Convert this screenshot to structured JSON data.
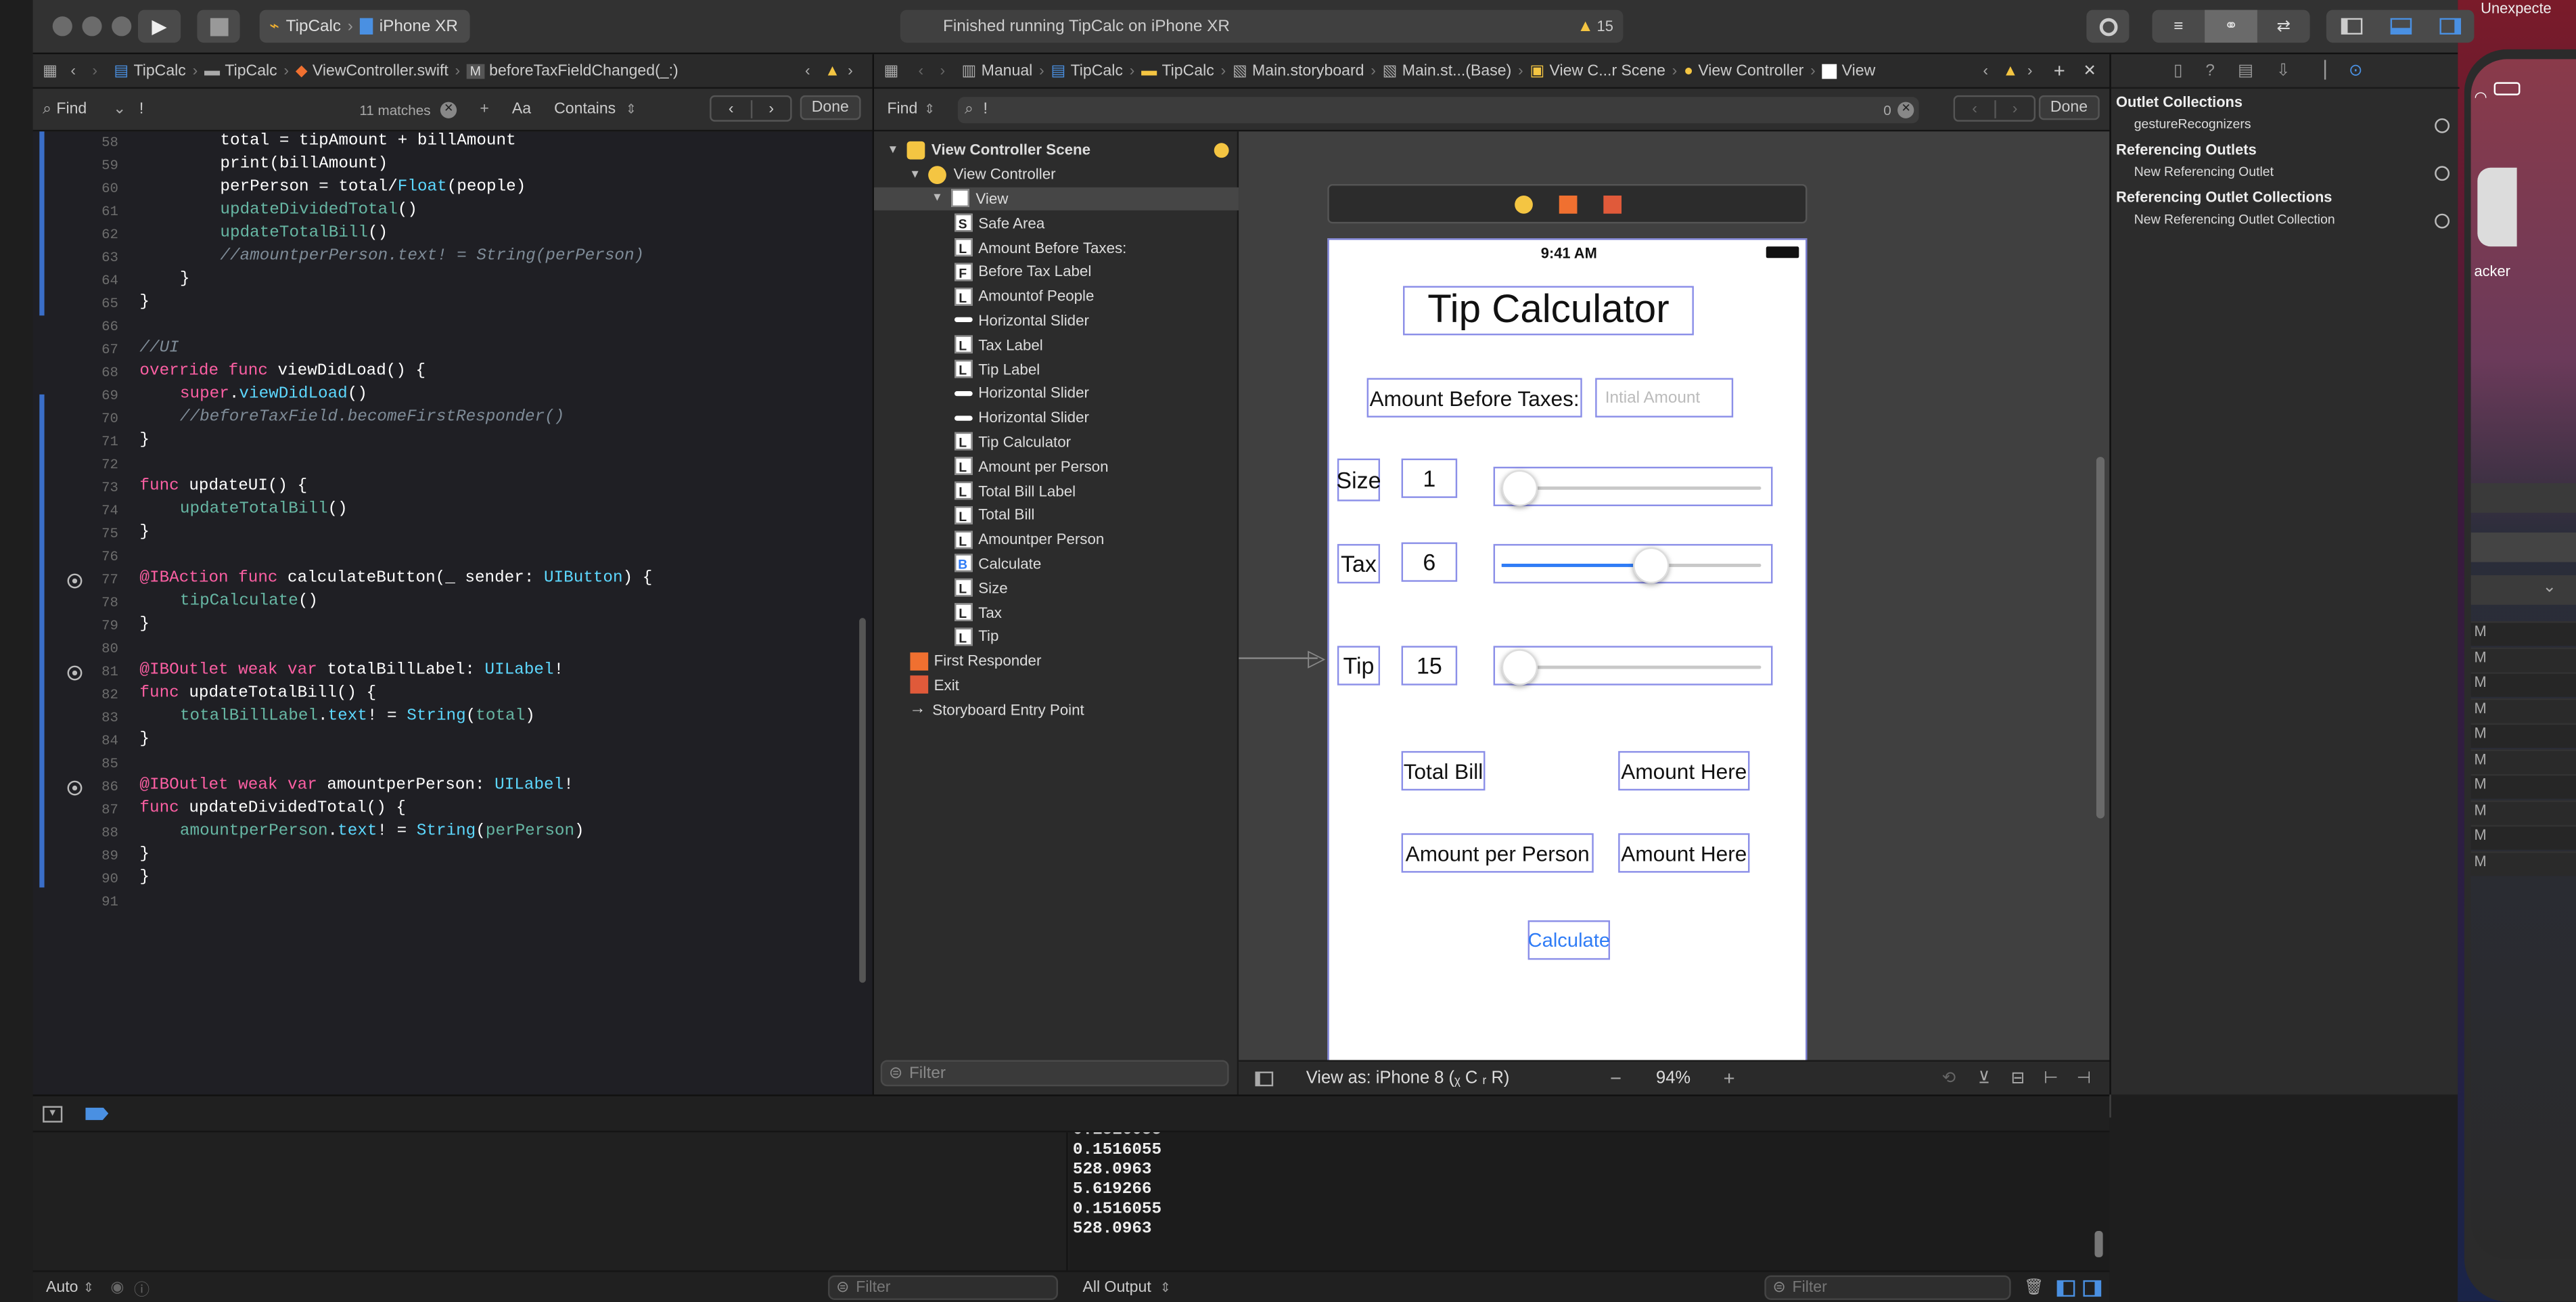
{
  "toolbar": {
    "scheme": "TipCalc",
    "device": "iPhone XR",
    "status": "Finished running TipCalc on iPhone XR",
    "warnings": "15"
  },
  "editor": {
    "jump": [
      "TipCalc",
      "TipCalc",
      "ViewController.swift",
      "M",
      "beforeTaxFieldChanged(_:)"
    ],
    "find": {
      "mode": "Find",
      "query": "!",
      "matches": "11 matches",
      "aa": "Aa",
      "contains": "Contains",
      "done": "Done"
    },
    "lines": [
      {
        "n": "58",
        "ind": 2,
        "t": [
          [
            "pl",
            "total = tipAmount + billAmount"
          ]
        ]
      },
      {
        "n": "59",
        "ind": 2,
        "t": [
          [
            "pl",
            "print(billAmount)"
          ]
        ]
      },
      {
        "n": "60",
        "ind": 2,
        "t": [
          [
            "pl",
            "perPerson = total/"
          ],
          [
            "ty",
            "Float"
          ],
          [
            "pl",
            "(people)"
          ]
        ]
      },
      {
        "n": "61",
        "ind": 2,
        "t": [
          [
            "fn",
            "updateDividedTotal"
          ],
          [
            "pl",
            "()"
          ]
        ]
      },
      {
        "n": "62",
        "ind": 2,
        "t": [
          [
            "fn",
            "updateTotalBill"
          ],
          [
            "pl",
            "()"
          ]
        ]
      },
      {
        "n": "63",
        "ind": 2,
        "t": [
          [
            "cm",
            "//amountperPerson.text! = String(perPerson)"
          ]
        ]
      },
      {
        "n": "64",
        "ind": 1,
        "t": [
          [
            "pl",
            "}"
          ]
        ]
      },
      {
        "n": "65",
        "ind": 0,
        "t": [
          [
            "pl",
            "}"
          ]
        ]
      },
      {
        "n": "66",
        "ind": 0,
        "t": []
      },
      {
        "n": "67",
        "ind": 0,
        "t": [
          [
            "cm",
            "//UI"
          ]
        ]
      },
      {
        "n": "68",
        "ind": 0,
        "t": [
          [
            "kw",
            "override func "
          ],
          [
            "pl",
            "viewDidLoad() {"
          ]
        ]
      },
      {
        "n": "69",
        "ind": 1,
        "t": [
          [
            "kw",
            "super"
          ],
          [
            "pl",
            "."
          ],
          [
            "ty",
            "viewDidLoad"
          ],
          [
            "pl",
            "()"
          ]
        ]
      },
      {
        "n": "70",
        "ind": 1,
        "t": [
          [
            "cm",
            "//beforeTaxField.becomeFirstResponder()"
          ]
        ]
      },
      {
        "n": "71",
        "ind": 0,
        "t": [
          [
            "pl",
            "}"
          ]
        ]
      },
      {
        "n": "72",
        "ind": 0,
        "t": []
      },
      {
        "n": "73",
        "ind": 0,
        "t": [
          [
            "kw",
            "func "
          ],
          [
            "pl",
            "updateUI() {"
          ]
        ]
      },
      {
        "n": "74",
        "ind": 1,
        "t": [
          [
            "fn",
            "updateTotalBill"
          ],
          [
            "pl",
            "()"
          ]
        ]
      },
      {
        "n": "75",
        "ind": 0,
        "t": [
          [
            "pl",
            "}"
          ]
        ]
      },
      {
        "n": "76",
        "ind": 0,
        "t": []
      },
      {
        "n": "77",
        "ind": 0,
        "bp": true,
        "t": [
          [
            "kw",
            "@IBAction func "
          ],
          [
            "pl",
            "calculateButton(_ sender: "
          ],
          [
            "ty",
            "UIButton"
          ],
          [
            "pl",
            ") {"
          ]
        ]
      },
      {
        "n": "78",
        "ind": 1,
        "t": [
          [
            "fn",
            "tipCalculate"
          ],
          [
            "pl",
            "()"
          ]
        ]
      },
      {
        "n": "79",
        "ind": 0,
        "t": [
          [
            "pl",
            "}"
          ]
        ]
      },
      {
        "n": "80",
        "ind": 0,
        "t": []
      },
      {
        "n": "81",
        "ind": 0,
        "bp": true,
        "t": [
          [
            "kw",
            "@IBOutlet weak var "
          ],
          [
            "pl",
            "totalBillLabel: "
          ],
          [
            "ty",
            "UILabel"
          ],
          [
            "pl",
            "!"
          ]
        ]
      },
      {
        "n": "82",
        "ind": 0,
        "t": [
          [
            "kw",
            "func "
          ],
          [
            "pl",
            "updateTotalBill() {"
          ]
        ]
      },
      {
        "n": "83",
        "ind": 1,
        "t": [
          [
            "fn",
            "totalBillLabel"
          ],
          [
            "pl",
            "."
          ],
          [
            "ty",
            "text"
          ],
          [
            "pl",
            "! = "
          ],
          [
            "ty",
            "String"
          ],
          [
            "pl",
            "("
          ],
          [
            "fn",
            "total"
          ],
          [
            "pl",
            ")"
          ]
        ]
      },
      {
        "n": "84",
        "ind": 0,
        "t": [
          [
            "pl",
            "}"
          ]
        ]
      },
      {
        "n": "85",
        "ind": 0,
        "t": []
      },
      {
        "n": "86",
        "ind": 0,
        "bp": true,
        "t": [
          [
            "kw",
            "@IBOutlet weak var "
          ],
          [
            "pl",
            "amountperPerson: "
          ],
          [
            "ty",
            "UILabel"
          ],
          [
            "pl",
            "!"
          ]
        ]
      },
      {
        "n": "87",
        "ind": 0,
        "t": [
          [
            "kw",
            "func "
          ],
          [
            "pl",
            "updateDividedTotal() {"
          ]
        ]
      },
      {
        "n": "88",
        "ind": 1,
        "t": [
          [
            "fn",
            "amountperPerson"
          ],
          [
            "pl",
            "."
          ],
          [
            "ty",
            "text"
          ],
          [
            "pl",
            "! = "
          ],
          [
            "ty",
            "String"
          ],
          [
            "pl",
            "("
          ],
          [
            "fn",
            "perPerson"
          ],
          [
            "pl",
            ")"
          ]
        ]
      },
      {
        "n": "89",
        "ind": 0,
        "t": [
          [
            "pl",
            "}"
          ]
        ]
      },
      {
        "n": "90",
        "ind": 0,
        "t": [
          [
            "pl",
            "}"
          ]
        ]
      },
      {
        "n": "91",
        "ind": 0,
        "t": []
      }
    ]
  },
  "ib": {
    "jump": [
      "Manual",
      "TipCalc",
      "TipCalc",
      "Main.storyboard",
      "Main.st...(Base)",
      "View C...r Scene",
      "View Controller",
      "View"
    ],
    "find": {
      "mode": "Find",
      "query": "!",
      "count": "0",
      "done": "Done"
    },
    "outline": [
      {
        "lvl": 0,
        "icon": "scene",
        "label": "View Controller Scene",
        "bold": true
      },
      {
        "lvl": 1,
        "icon": "vc",
        "label": "View Controller"
      },
      {
        "lvl": 2,
        "icon": "view",
        "label": "View",
        "sel": true
      },
      {
        "lvl": 3,
        "icon": "S",
        "label": "Safe Area"
      },
      {
        "lvl": 3,
        "icon": "L",
        "label": "Amount Before Taxes:"
      },
      {
        "lvl": 3,
        "icon": "F",
        "label": "Before Tax Label"
      },
      {
        "lvl": 3,
        "icon": "L",
        "label": "Amountof People"
      },
      {
        "lvl": 3,
        "icon": "slider",
        "label": "Horizontal Slider"
      },
      {
        "lvl": 3,
        "icon": "L",
        "label": "Tax Label"
      },
      {
        "lvl": 3,
        "icon": "L",
        "label": "Tip Label"
      },
      {
        "lvl": 3,
        "icon": "slider",
        "label": "Horizontal Slider"
      },
      {
        "lvl": 3,
        "icon": "slider",
        "label": "Horizontal Slider"
      },
      {
        "lvl": 3,
        "icon": "L",
        "label": "Tip Calculator"
      },
      {
        "lvl": 3,
        "icon": "L",
        "label": "Amount per Person"
      },
      {
        "lvl": 3,
        "icon": "L",
        "label": "Total Bill Label"
      },
      {
        "lvl": 3,
        "icon": "L",
        "label": "Total Bill"
      },
      {
        "lvl": 3,
        "icon": "L",
        "label": "Amountper Person"
      },
      {
        "lvl": 3,
        "icon": "B",
        "label": "Calculate"
      },
      {
        "lvl": 3,
        "icon": "L",
        "label": "Size"
      },
      {
        "lvl": 3,
        "icon": "L",
        "label": "Tax"
      },
      {
        "lvl": 3,
        "icon": "L",
        "label": "Tip"
      },
      {
        "lvl": 1,
        "icon": "fr",
        "label": "First Responder"
      },
      {
        "lvl": 1,
        "icon": "exit",
        "label": "Exit"
      },
      {
        "lvl": 1,
        "icon": "arrow",
        "label": "Storyboard Entry Point"
      }
    ],
    "filter": "Filter",
    "viewas": "View as: iPhone 8 (ᵪ C ᵣ R)",
    "zoom": "94%",
    "phone": {
      "time": "9:41 AM",
      "title": "Tip Calculator",
      "amount_label": "Amount Before Taxes:",
      "amount_placeholder": "Intial Amount",
      "size_label": "Size",
      "size_value": "1",
      "size_slider": 0.0,
      "tax_label": "Tax",
      "tax_value": "6",
      "tax_slider": 0.58,
      "tip_label": "Tip",
      "tip_value": "15",
      "tip_slider": 0.0,
      "total_bill": "Total Bill",
      "amount_here_1": "Amount Here",
      "amount_per_person": "Amount per Person",
      "amount_here_2": "Amount Here",
      "calculate": "Calculate"
    }
  },
  "inspector": {
    "sections": [
      {
        "title": "Outlet Collections",
        "items": [
          "gestureRecognizers"
        ]
      },
      {
        "title": "Referencing Outlets",
        "items": [
          "New Referencing Outlet"
        ]
      },
      {
        "title": "Referencing Outlet Collections",
        "items": [
          "New Referencing Outlet Collection"
        ]
      }
    ]
  },
  "debug": {
    "output": [
      "0.1516055",
      "528.0963",
      "5.619266",
      "0.1516055",
      "528.0963"
    ],
    "auto": "Auto",
    "filter_left": "Filter",
    "all_output": "All Output",
    "filter_right": "Filter"
  },
  "sim": {
    "app_label": "acker",
    "top_right": "Unexpecte",
    "list": [
      "M",
      "M",
      "M",
      "M",
      "M",
      "M",
      "M",
      "M",
      "M",
      "M"
    ]
  }
}
